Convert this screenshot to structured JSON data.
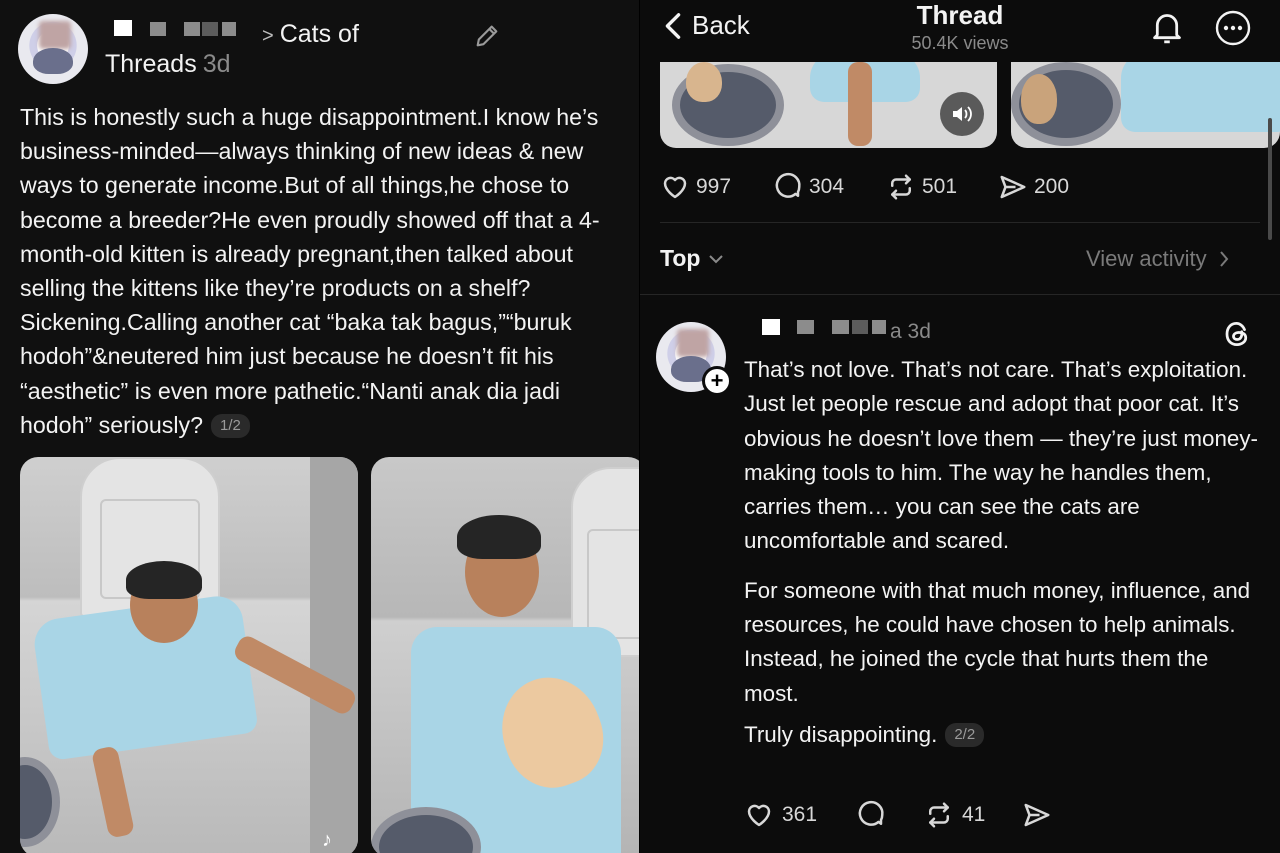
{
  "left_post": {
    "breadcrumb_separator": ">",
    "topic_line1": "Cats of",
    "topic_line2": "Threads",
    "time": "3d",
    "body": "This is honestly such a huge disappointment.I know he’s business-minded—always thinking of new ideas & new ways to generate income.But of all things,he chose to become a breeder?He even proudly showed off that a 4-month-old kitten is already pregnant,then talked about selling the kittens like they’re products on a shelf?Sickening.Calling another cat “baka tak bagus,”“buruk hodoh”&neutered him just because he doesn’t fit his “aesthetic” is even more pathetic.“Nanti anak dia jadi hodoh” seriously?",
    "pager": "1/2",
    "icons": {
      "edit": "pencil-icon"
    }
  },
  "right_post": {
    "header": {
      "back_label": "Back",
      "title": "Thread",
      "views": "50.4K views",
      "icons": {
        "bell": "bell-icon",
        "more": "more-icon",
        "back": "chevron-left-icon"
      }
    },
    "stats": {
      "likes": "997",
      "replies": "304",
      "reposts": "501",
      "shares": "200"
    },
    "sort_label": "Top",
    "view_activity": "View activity",
    "reply": {
      "time": "3d",
      "paragraph1": "That’s not love. That’s not care. That’s exploitation. Just let people rescue and adopt that poor cat. It’s obvious he doesn’t love them — they’re just money-making tools to him. The way he handles them, carries them… you can see the cats are uncomfortable and scared.",
      "paragraph2": "For someone with that much money, influence, and resources, he could have chosen to help animals. Instead, he joined the cycle that hurts them the most.",
      "paragraph3": "Truly disappointing.",
      "pager": "2/2",
      "likes": "361",
      "reposts": "41",
      "icons": {
        "heart": "heart-icon",
        "reply": "comment-icon",
        "repost": "repost-icon",
        "share": "share-icon",
        "threads": "threads-logo-icon"
      }
    }
  },
  "colors": {
    "background": "#101010",
    "text": "#f3f3f3",
    "muted": "#8a8a8a",
    "scrubs": "#a9d5e6"
  }
}
